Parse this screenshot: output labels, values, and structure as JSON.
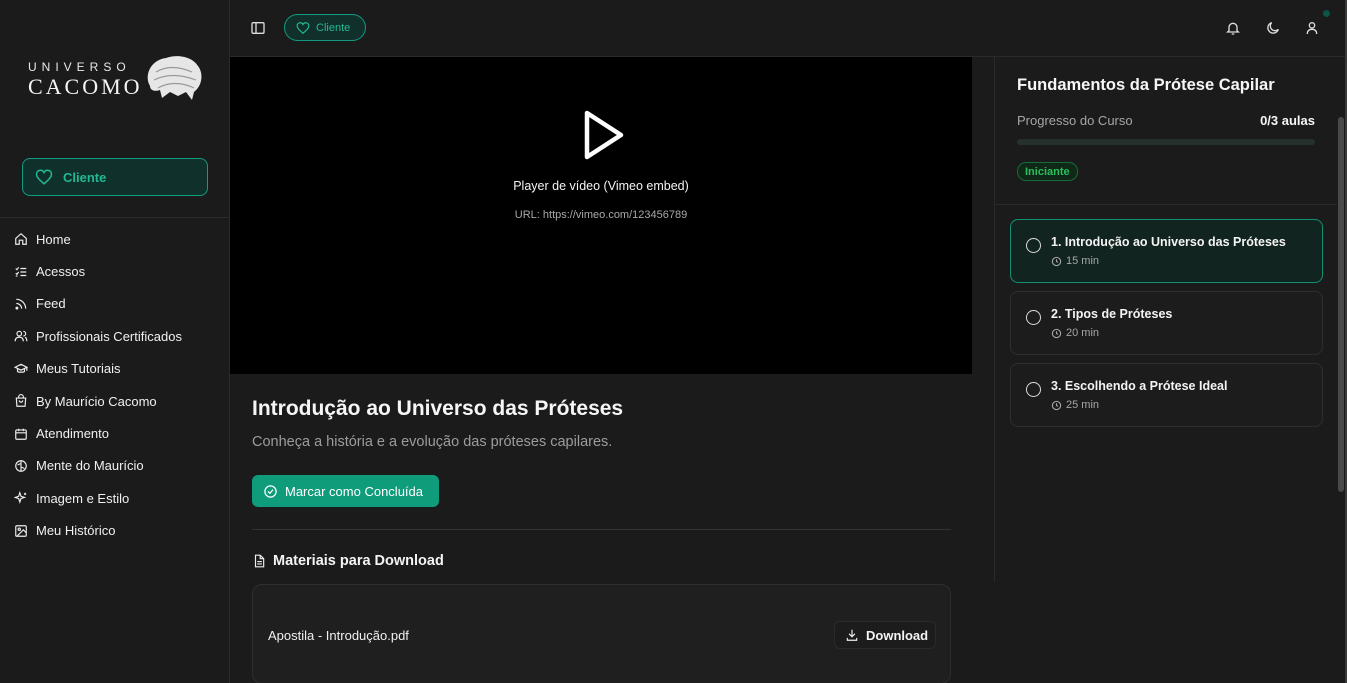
{
  "logo": {
    "top": "UNIVERSO",
    "main": "CACOMO"
  },
  "sidebar": {
    "cliente_label": "Cliente",
    "items": [
      {
        "label": "Home",
        "icon": "home-icon"
      },
      {
        "label": "Acessos",
        "icon": "list-check-icon"
      },
      {
        "label": "Feed",
        "icon": "rss-icon"
      },
      {
        "label": "Profissionais Certificados",
        "icon": "users-icon"
      },
      {
        "label": "Meus Tutoriais",
        "icon": "graduation-cap-icon"
      },
      {
        "label": "By Maurício Cacomo",
        "icon": "shopping-bag-icon"
      },
      {
        "label": "Atendimento",
        "icon": "calendar-icon"
      },
      {
        "label": "Mente do Maurício",
        "icon": "brain-icon"
      },
      {
        "label": "Imagem e Estilo",
        "icon": "sparkles-icon"
      },
      {
        "label": "Meu Histórico",
        "icon": "image-icon"
      }
    ]
  },
  "topbar": {
    "cliente_label": "Cliente",
    "icons": [
      "sidebar-toggle-icon",
      "heart-icon",
      "bell-icon",
      "moon-icon",
      "user-icon"
    ]
  },
  "video": {
    "title": "Player de vídeo (Vimeo embed)",
    "url": "URL: https://vimeo.com/123456789"
  },
  "lesson": {
    "title": "Introdução ao Universo das Próteses",
    "subtitle": "Conheça a história e a evolução das próteses capilares.",
    "complete_button": "Marcar como Concluída",
    "materials_title": "Materiais para Download",
    "materials": [
      {
        "name": "Apostila - Introdução.pdf",
        "action": "Download"
      }
    ]
  },
  "course": {
    "title": "Fundamentos da Prótese Capilar",
    "progress_label": "Progresso do Curso",
    "progress_count": "0/3 aulas",
    "progress_fraction": 0,
    "level": "Iniciante",
    "lessons": [
      {
        "name": "1. Introdução ao Universo das Próteses",
        "duration": "15 min",
        "active": true
      },
      {
        "name": "2. Tipos de Próteses",
        "duration": "20 min",
        "active": false
      },
      {
        "name": "3. Escolhendo a Prótese Ideal",
        "duration": "25 min",
        "active": false
      }
    ]
  },
  "colors": {
    "accent": "#0f9c7a",
    "accent_text": "#23b894",
    "background": "#1b1b1b",
    "badge_green": "#2bbf5b"
  }
}
